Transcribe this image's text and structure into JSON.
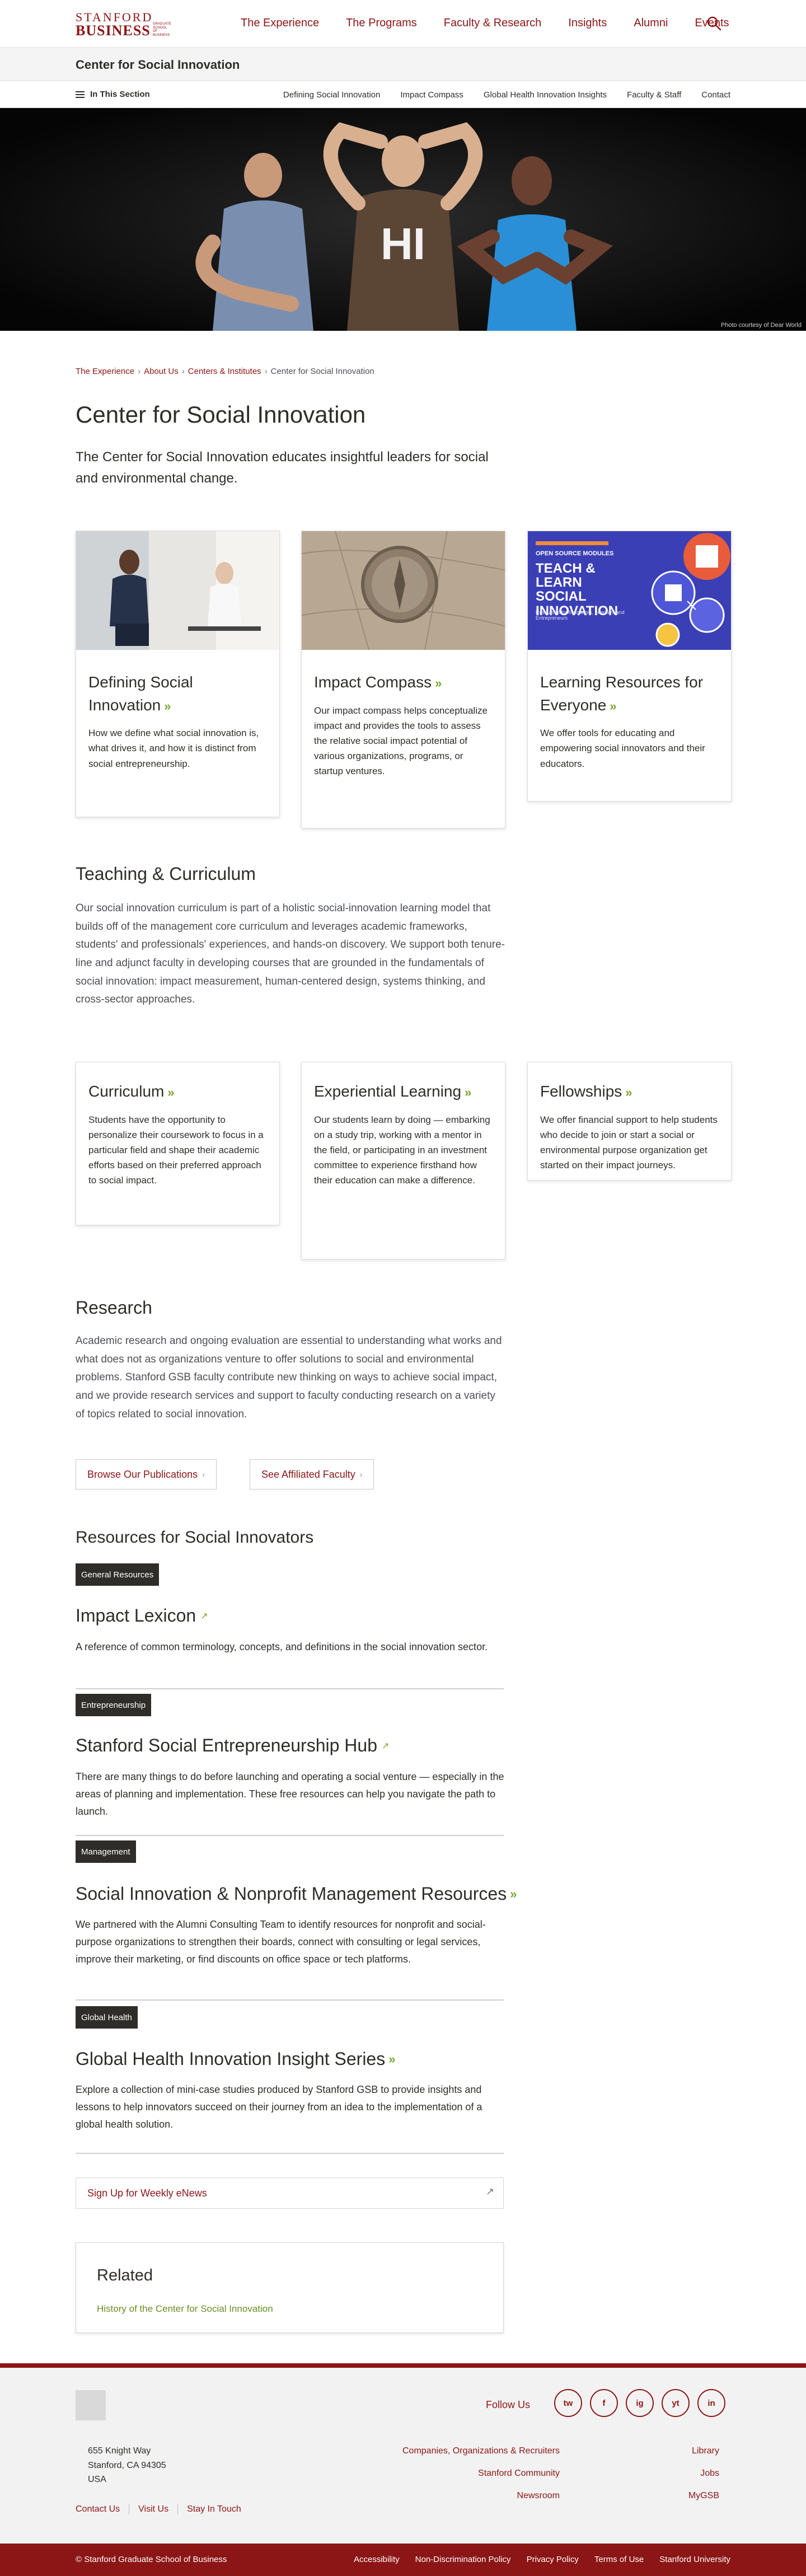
{
  "header": {
    "logo_line1": "STANFORD",
    "logo_line2": "BUSINESS",
    "logo_gsb": "GRADUATE SCHOOL OF BUSINESS",
    "nav": [
      "The Experience",
      "The Programs",
      "Faculty & Research",
      "Insights",
      "Alumni",
      "Events"
    ],
    "search_icon": "search-icon"
  },
  "section_bar": {
    "title": "Center for Social Innovation"
  },
  "subnav": {
    "in_section": "In This Section",
    "links": [
      "Defining Social Innovation",
      "Impact Compass",
      "Global Health Innovation Insights",
      "Faculty & Staff",
      "Contact"
    ]
  },
  "hero": {
    "credit": "Photo courtesy of Dear World",
    "shirt_text": "HI"
  },
  "breadcrumb": [
    "The Experience",
    "About Us",
    "Centers & Institutes",
    "Center for Social Innovation"
  ],
  "page_title": "Center for Social Innovation",
  "lead": "The Center for Social Innovation educates insightful leaders for social and environmental change.",
  "intro_cards": [
    {
      "title": "Defining Social Innovation",
      "text": "How we define what social innovation is, what drives it, and how it is distinct from social entrepreneurship."
    },
    {
      "title": "Impact Compass",
      "text": "Our impact compass helps conceptualize impact and provides the tools to assess the relative social impact potential of various organizations, programs, or startup ventures."
    },
    {
      "title": "Learning Resources for Everyone",
      "text": "We offer tools for educating and empowering social innovators and their educators."
    }
  ],
  "promo_image": {
    "kicker": "OPEN SOURCE MODULES",
    "title": "TEACH & LEARN SOCIAL INNOVATION",
    "sub": "Resources for Instructors, Learners and Entrepreneurs"
  },
  "teaching": {
    "heading": "Teaching & Curriculum",
    "text": "Our social innovation curriculum is part of a holistic social-innovation learning model that builds off of the management core curriculum and leverages academic frameworks, students' and professionals' experiences, and hands-on discovery. We support both tenure-line and adjunct faculty in developing courses that are grounded in the fundamentals of social innovation: impact measurement, human-centered design, systems thinking, and cross-sector approaches."
  },
  "teaching_cards": [
    {
      "title": "Curriculum",
      "text": "Students have the opportunity to personalize their coursework to focus in a particular field and shape their academic efforts based on their preferred approach to social impact."
    },
    {
      "title": "Experiential Learning",
      "text": "Our students learn by doing — embarking on a study trip, working with a mentor in the field, or participating in an investment committee to experience firsthand how their education can make a difference."
    },
    {
      "title": "Fellowships",
      "text": "We offer financial support to help students who decide to join or start a social or environmental purpose organization get started on their impact journeys."
    }
  ],
  "research": {
    "heading": "Research",
    "text": "Academic research and ongoing evaluation are essential to understanding what works and what does not as organizations venture to offer solutions to social and environmental problems. Stanford GSB faculty contribute new thinking on ways to achieve social impact, and we provide research services and support to faculty conducting research on a variety of topics related to social innovation.",
    "btn1": "Browse Our Publications",
    "btn2": "See Affiliated Faculty"
  },
  "resources": {
    "heading": "Resources for Social Innovators",
    "items": [
      {
        "tag": "General Resources",
        "title": "Impact Lexicon",
        "text": "A reference of common terminology, concepts, and definitions in the social innovation sector."
      },
      {
        "tag": "Entrepreneurship",
        "title": "Stanford Social Entrepreneurship Hub",
        "text": "There are many things to do before launching and operating a social venture — especially in the areas of planning and implementation. These free resources can help you navigate the path to launch."
      },
      {
        "tag": "Management",
        "title": "Social Innovation & Nonprofit Management Resources",
        "text": "We partnered with the Alumni Consulting Team to identify resources for nonprofit and social-purpose organizations to strengthen their boards, connect with consulting or legal services, improve their marketing, or find discounts on office space or tech platforms."
      },
      {
        "tag": "Global Health",
        "title": "Global Health Innovation Insight Series",
        "text": "Explore a collection of mini-case studies produced by Stanford GSB to provide insights and lessons to help innovators succeed on their journey from an idea to the implementation of a global health solution."
      }
    ]
  },
  "enews": "Sign Up for Weekly eNews",
  "related": {
    "heading": "Related",
    "link": "History of the Center for Social Innovation"
  },
  "footer": {
    "follow": "Follow Us",
    "social": [
      "tw",
      "f",
      "ig",
      "yt",
      "in"
    ],
    "address": [
      "655 Knight Way",
      "Stanford, CA 94305",
      "USA"
    ],
    "links": [
      "Contact Us",
      "Visit Us",
      "Stay In Touch"
    ],
    "col1": [
      "Companies, Organizations & Recruiters",
      "Stanford Community",
      "Newsroom"
    ],
    "col2": [
      "Library",
      "Jobs",
      "MyGSB"
    ],
    "copyright": "© Stanford Graduate School of Business",
    "bottom_links": [
      "Accessibility",
      "Non-Discrimination Policy",
      "Privacy Policy",
      "Terms of Use",
      "Stanford University"
    ]
  },
  "colors": {
    "cardinal": "#8c1515",
    "accent_green": "#7aa62c",
    "promo_blue": "#3b3fb5"
  }
}
